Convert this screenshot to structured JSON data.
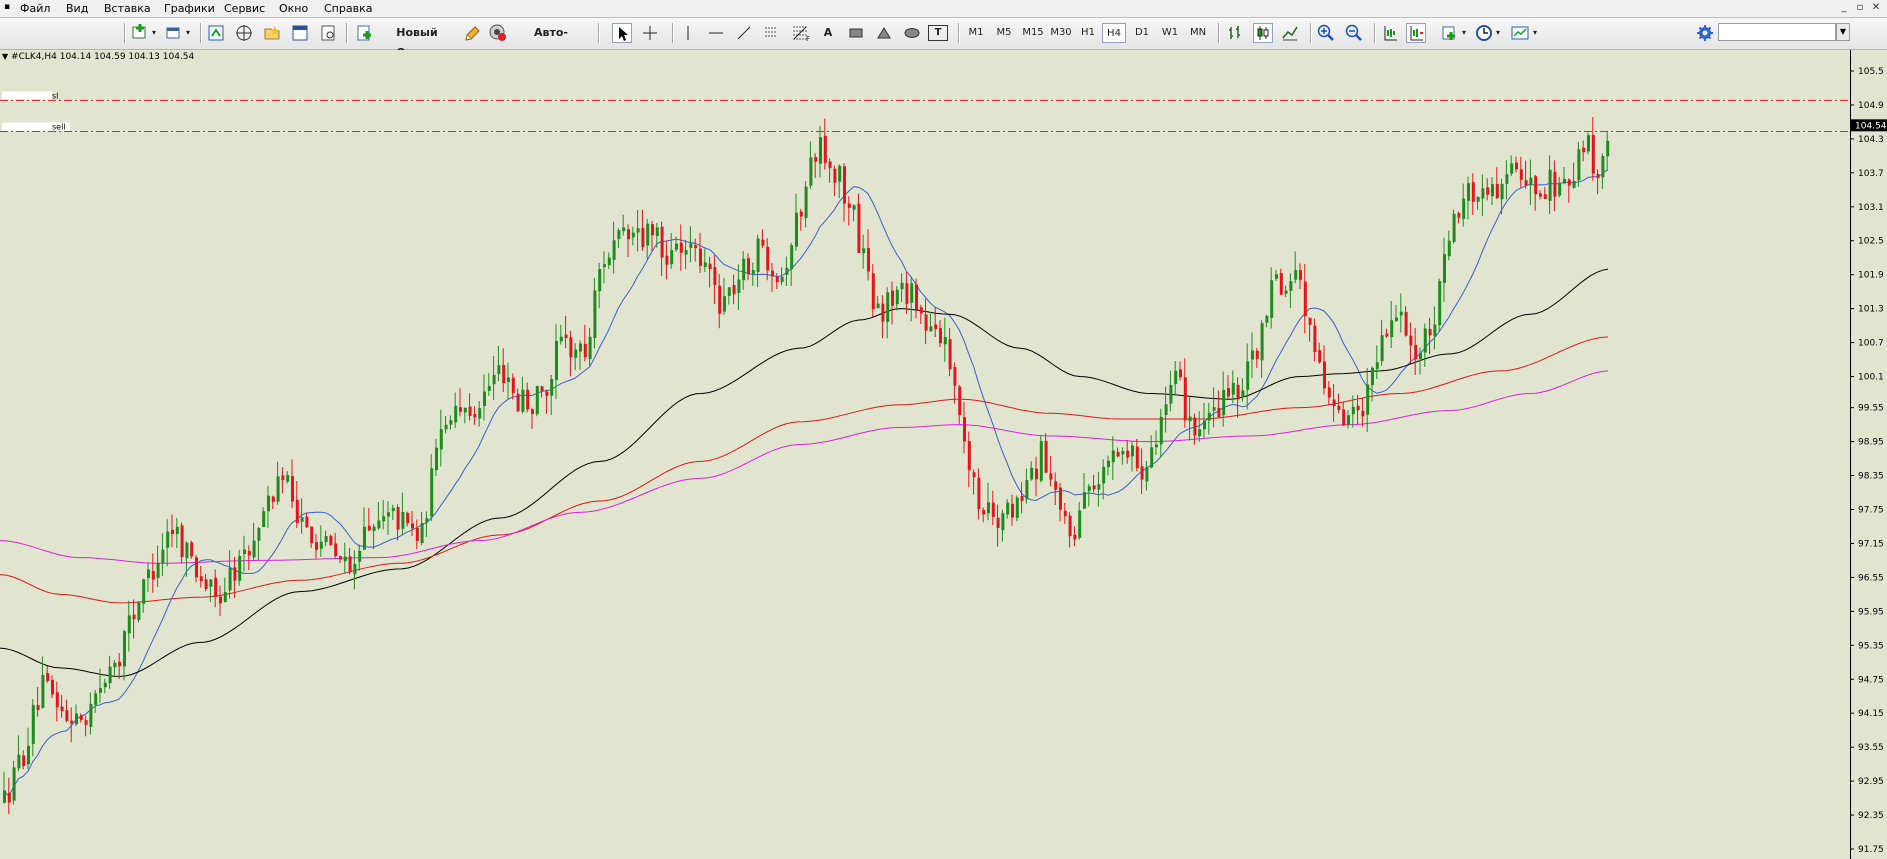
{
  "menu": [
    "Файл",
    "Вид",
    "Вставка",
    "Графики",
    "Сервис",
    "Окно",
    "Справка"
  ],
  "toolbar": {
    "new_order_label": "Новый Ордер",
    "autotrading_label": "Авто-торговля",
    "timeframes": [
      "M1",
      "M5",
      "M15",
      "M30",
      "H1",
      "H4",
      "D1",
      "W1",
      "MN"
    ],
    "active_timeframe": "H4",
    "text_tool": "A",
    "text_label_tool": "T"
  },
  "chart": {
    "symbol_line": "#CLK4,H4  104.14 104.59 104.13 104.54",
    "line_labels": {
      "sl": "sl",
      "sell": "sell"
    },
    "current_price": "104.54",
    "price_ticks": [
      "105.5",
      "104.9",
      "104.3",
      "103.7",
      "103.1",
      "102.5",
      "101.9",
      "101.3",
      "100.7",
      "100.1",
      "99.55",
      "98.95",
      "98.35",
      "97.75",
      "97.15",
      "96.55",
      "95.95",
      "95.35",
      "94.75",
      "94.15",
      "93.55",
      "92.95",
      "92.35",
      "91.75"
    ],
    "colors": {
      "background": "#e1e5cf",
      "bull": "#1f8b1f",
      "bear": "#e4141a",
      "ma_fast": "#3a5fd0",
      "ma_mid": "#000000",
      "ma_slow_red": "#e01818",
      "ma_slow_magenta": "#e020e0",
      "sl_line": "#e4141a",
      "sell_line": "#1f8b1f"
    }
  }
}
